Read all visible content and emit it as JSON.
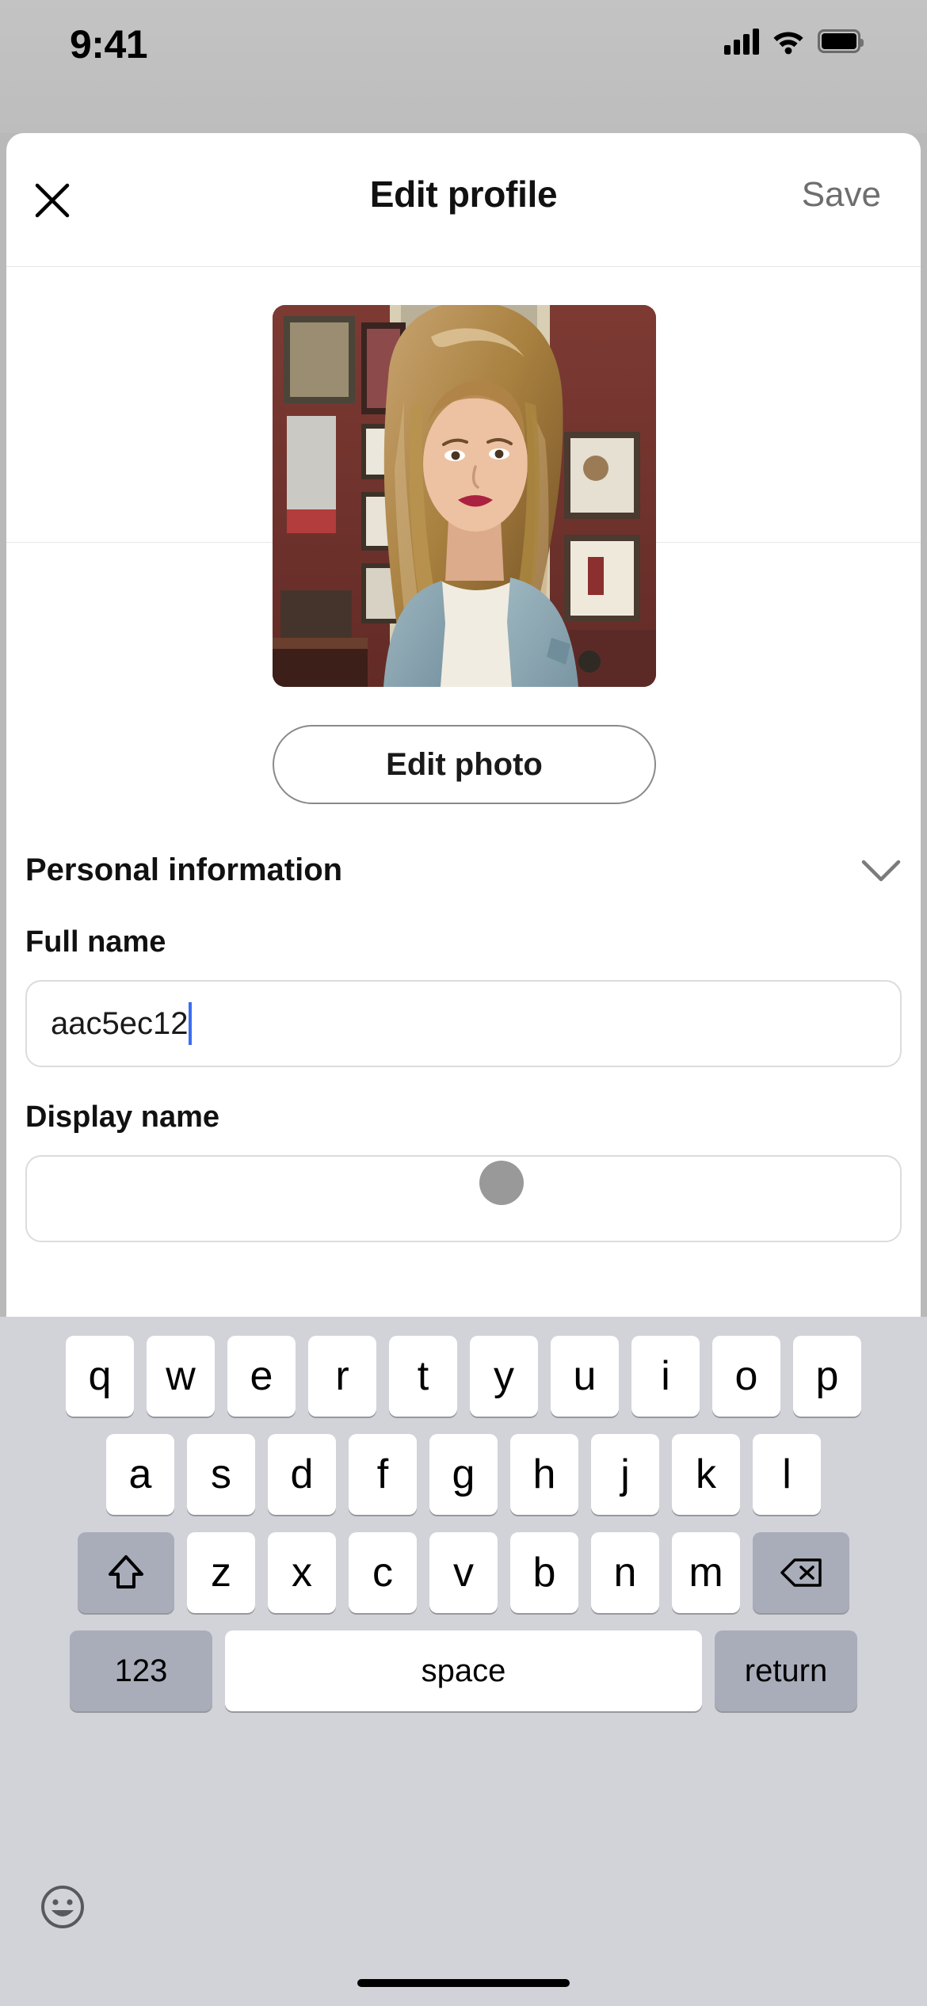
{
  "status_bar": {
    "time": "9:41",
    "icons": [
      "cellular-signal-icon",
      "wifi-icon",
      "battery-icon"
    ]
  },
  "header": {
    "close_icon": "close-icon",
    "title": "Edit profile",
    "save_label": "Save"
  },
  "photo_section": {
    "avatar_alt": "profile-photo",
    "edit_photo_label": "Edit photo"
  },
  "form": {
    "section_title": "Personal information",
    "section_chevron": "chevron-down-icon",
    "fields": [
      {
        "label": "Full name",
        "value": "aac5ec12",
        "placeholder": "Full name",
        "focused": true
      },
      {
        "label": "Display name",
        "value": "",
        "placeholder": "Display name",
        "focused": false
      }
    ]
  },
  "tap_indicator": {
    "name": "touch-point"
  },
  "keyboard": {
    "row1": [
      "q",
      "w",
      "e",
      "r",
      "t",
      "y",
      "u",
      "i",
      "o",
      "p"
    ],
    "row2": [
      "a",
      "s",
      "d",
      "f",
      "g",
      "h",
      "j",
      "k",
      "l"
    ],
    "row3": [
      "z",
      "x",
      "c",
      "v",
      "b",
      "n",
      "m"
    ],
    "shift_icon": "shift-arrow-icon",
    "backspace_icon": "backspace-icon",
    "numbers_label": "123",
    "space_label": "space",
    "return_label": "return",
    "emoji_icon": "emoji-smiley-icon"
  },
  "colors": {
    "sheet_background": "#ffffff",
    "page_background": "#b9b9b9",
    "keyboard_background": "#d1d3d9",
    "key_background": "#ffffff",
    "key_dark_background": "#a9adb9",
    "caret": "#3b6ef0",
    "save_text": "#6e6e6e",
    "tap_indicator": "#999999"
  }
}
